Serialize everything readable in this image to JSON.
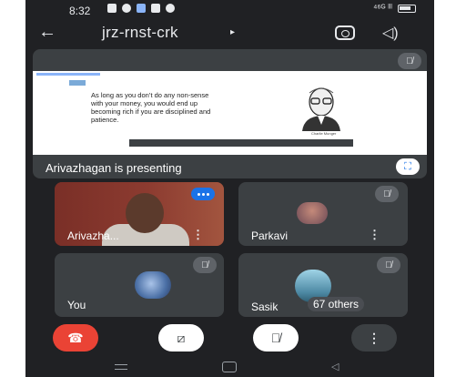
{
  "status_bar": {
    "time": "8:32",
    "signal_text": "⁴⁶ᴳ ˡˡˡ"
  },
  "header": {
    "meeting_code": "jrz-rnst-crk",
    "dropdown_glyph": "▸",
    "back_glyph": "←",
    "speaker_glyph": "◁)"
  },
  "presentation": {
    "quote": "As long as you don’t do any non-sense with your money, you would end up becoming rich if you are disciplined and patience.",
    "portrait_caption": "Charlie Munger",
    "presenting_label": "Arivazhagan is presenting",
    "fullscreen_glyph": "⛶"
  },
  "participants": [
    {
      "name": "Arivazha...",
      "muted": false,
      "speaking": true
    },
    {
      "name": "Parkavi",
      "muted": true
    },
    {
      "name": "You",
      "muted": true
    },
    {
      "name": "Sasik",
      "muted": true,
      "others_label": "67 others"
    }
  ],
  "icons": {
    "mic_off": "🎙̸",
    "more": "⋮",
    "end_call": "☎",
    "camera_off": "⧄",
    "mic_off_button": "🎙̸"
  },
  "colors": {
    "background": "#202124",
    "tile": "#3c4043",
    "end_call": "#ea4335",
    "accent": "#1a73e8"
  }
}
